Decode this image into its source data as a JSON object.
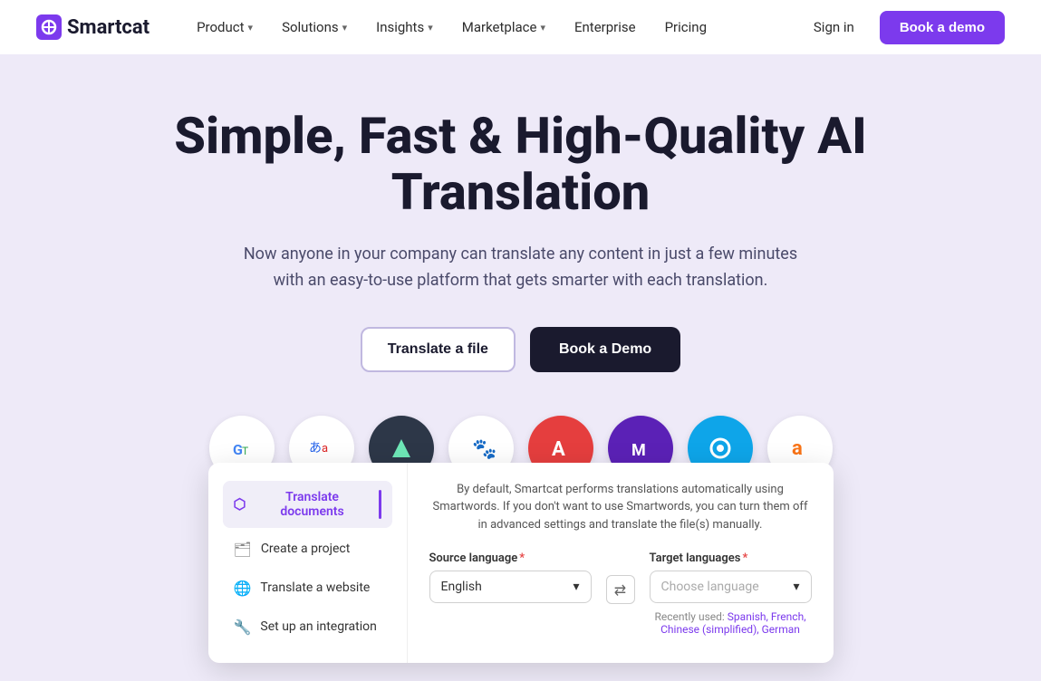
{
  "navbar": {
    "logo_text": "Smartcat",
    "nav_items": [
      {
        "id": "product",
        "label": "Product",
        "has_dropdown": true
      },
      {
        "id": "solutions",
        "label": "Solutions",
        "has_dropdown": true
      },
      {
        "id": "insights",
        "label": "Insights",
        "has_dropdown": true
      },
      {
        "id": "marketplace",
        "label": "Marketplace",
        "has_dropdown": true
      },
      {
        "id": "enterprise",
        "label": "Enterprise",
        "has_dropdown": false
      },
      {
        "id": "pricing",
        "label": "Pricing",
        "has_dropdown": false
      }
    ],
    "sign_in": "Sign in",
    "book_demo": "Book a demo"
  },
  "hero": {
    "title": "Simple, Fast & High-Quality AI Translation",
    "subtitle": "Now anyone in your company can translate any content in just a few minutes with an easy-to-use platform that gets smarter with each translation.",
    "btn_translate": "Translate a file",
    "btn_book": "Book a Demo"
  },
  "logos": [
    {
      "id": "google-translate",
      "symbol": "G"
    },
    {
      "id": "localize",
      "symbol": "あa"
    },
    {
      "id": "smartling",
      "symbol": "▶"
    },
    {
      "id": "baidu",
      "symbol": "🐾"
    },
    {
      "id": "acrolinx",
      "symbol": "A"
    },
    {
      "id": "modernmt",
      "symbol": "M"
    },
    {
      "id": "deepl",
      "symbol": "◎"
    },
    {
      "id": "amazon",
      "symbol": "a"
    }
  ],
  "dropdown": {
    "description": "By default, Smartcat performs translations automatically using Smartwords. If you don't want to use Smartwords, you can turn them off in advanced settings and translate the file(s) manually.",
    "menu_items": [
      {
        "id": "translate-docs",
        "label": "Translate documents",
        "icon": "📄",
        "active": true
      },
      {
        "id": "create-project",
        "label": "Create a project",
        "icon": "🗂"
      },
      {
        "id": "translate-website",
        "label": "Translate a website",
        "icon": "🌐"
      },
      {
        "id": "set-integration",
        "label": "Set up an integration",
        "icon": "🔧"
      }
    ],
    "source_language_label": "Source language",
    "source_language_required": true,
    "source_language_value": "English",
    "target_language_label": "Target languages",
    "target_language_required": true,
    "target_language_placeholder": "Choose language",
    "recently_used_label": "Recently used:",
    "recently_used": "Spanish, French, Chinese (simplified), German"
  }
}
